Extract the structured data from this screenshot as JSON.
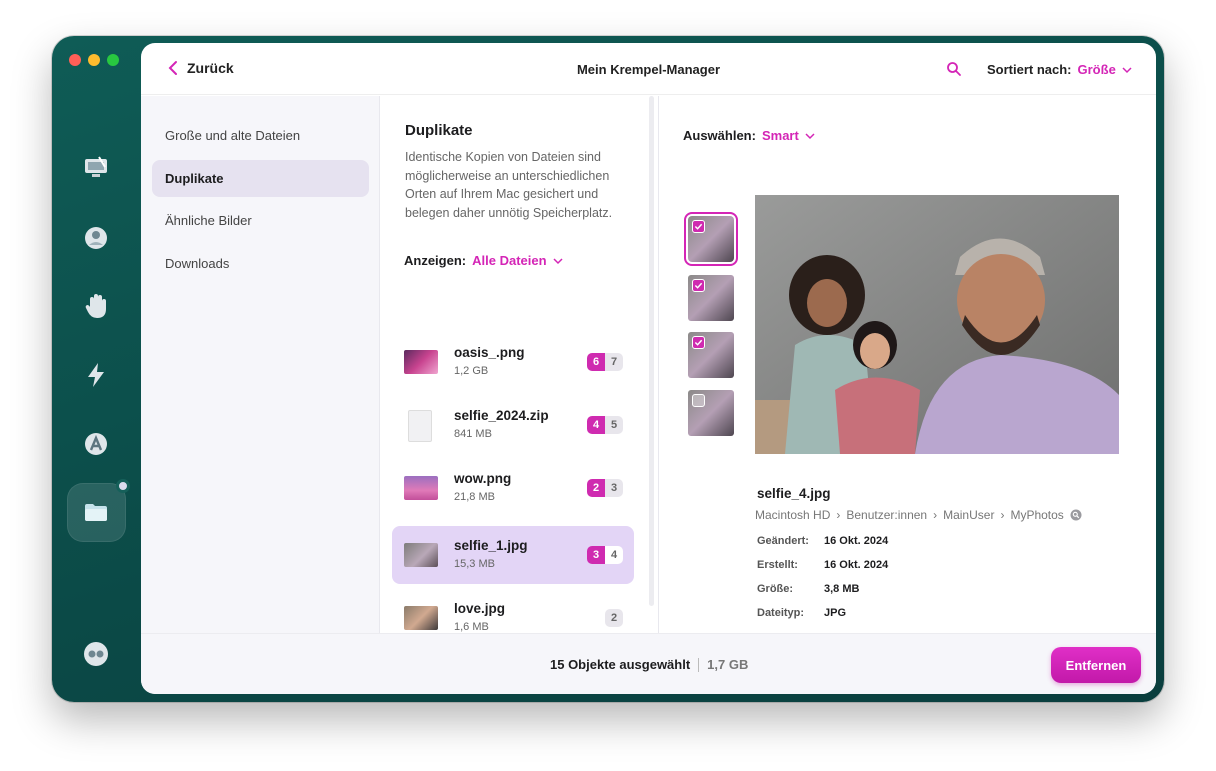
{
  "header": {
    "back_label": "Zurück",
    "title": "Mein Krempel-Manager",
    "sort_label": "Sortiert nach:",
    "sort_value": "Größe"
  },
  "sidebar": {
    "items": [
      {
        "label": "Große und alte Dateien"
      },
      {
        "label": "Duplikate"
      },
      {
        "label": "Ähnliche Bilder"
      },
      {
        "label": "Downloads"
      }
    ]
  },
  "list": {
    "title": "Duplikate",
    "description": "Identische Kopien von Dateien sind möglicherweise an unterschiedlichen Orten auf Ihrem Mac gesichert und belegen daher unnötig Speicherplatz.",
    "show_label": "Anzeigen:",
    "show_value": "Alle Dateien",
    "files": [
      {
        "name": "oasis_.png",
        "size": "1,2 GB",
        "selected": "6",
        "total": "7"
      },
      {
        "name": "selfie_2024.zip",
        "size": "841 MB",
        "selected": "4",
        "total": "5"
      },
      {
        "name": "wow.png",
        "size": "21,8 MB",
        "selected": "2",
        "total": "3"
      },
      {
        "name": "selfie_1.jpg",
        "size": "15,3 MB",
        "selected": "3",
        "total": "4"
      },
      {
        "name": "love.jpg",
        "size": "1,6 MB",
        "selected": "",
        "total": "2"
      }
    ]
  },
  "detail": {
    "select_label": "Auswählen:",
    "select_value": "Smart",
    "file_name": "selfie_4.jpg",
    "path": [
      "Macintosh HD",
      "Benutzer:innen",
      "MainUser",
      "MyPhotos"
    ],
    "meta": [
      {
        "label": "Geändert:",
        "value": "16 Okt. 2024"
      },
      {
        "label": "Erstellt:",
        "value": "16 Okt. 2024"
      },
      {
        "label": "Größe:",
        "value": "3,8 MB"
      },
      {
        "label": "Dateityp:",
        "value": "JPG"
      }
    ]
  },
  "footer": {
    "summary": "15 Objekte ausgewählt",
    "size": "1,7 GB",
    "remove_label": "Entfernen"
  },
  "colors": {
    "accent": "#d425b6",
    "rail": "#0f5c56"
  }
}
